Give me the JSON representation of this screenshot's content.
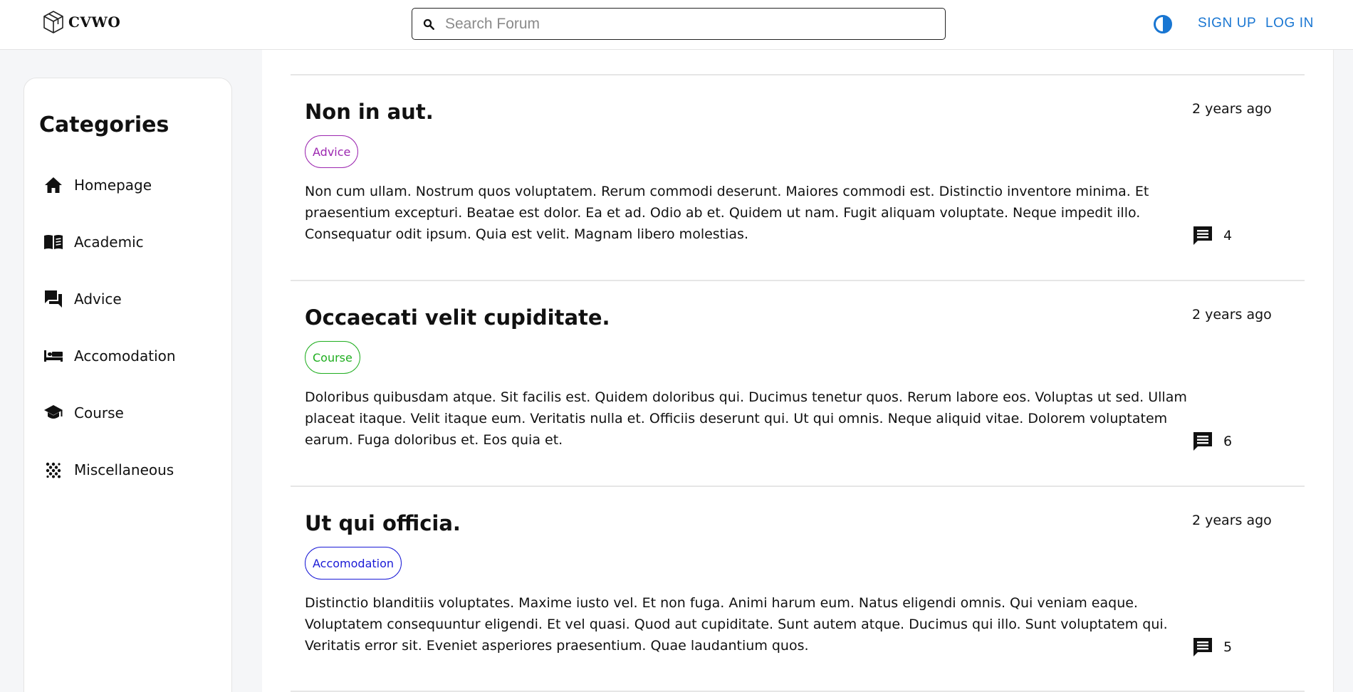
{
  "header": {
    "logo_text": "CVWO",
    "search_placeholder": "Search Forum",
    "signup_label": "SIGN UP",
    "login_label": "LOG IN",
    "accent_color": "#1976d2"
  },
  "sidebar": {
    "title": "Categories",
    "items": [
      {
        "label": "Homepage",
        "icon": "home-icon"
      },
      {
        "label": "Academic",
        "icon": "book-icon"
      },
      {
        "label": "Advice",
        "icon": "forum-icon"
      },
      {
        "label": "Accomodation",
        "icon": "bed-icon"
      },
      {
        "label": "Course",
        "icon": "school-icon"
      },
      {
        "label": "Miscellaneous",
        "icon": "scatter-icon"
      }
    ]
  },
  "posts": [
    {
      "title": "Non in aut.",
      "time": "2 years ago",
      "tag": "Advice",
      "tag_color": "#9c27b0",
      "body": "Non cum ullam. Nostrum quos voluptatem. Rerum commodi deserunt. Maiores commodi est. Distinctio inventore minima. Et praesentium excepturi. Beatae est dolor. Ea et ad. Odio ab et. Quidem ut nam. Fugit aliquam voluptate. Neque impedit illo. Consequatur odit ipsum. Quia est velit. Magnam libero molestias.",
      "comments": "4"
    },
    {
      "title": "Occaecati velit cupiditate.",
      "time": "2 years ago",
      "tag": "Course",
      "tag_color": "#1fae1f",
      "body": "Doloribus quibusdam atque. Sit facilis est. Quidem doloribus qui. Ducimus tenetur quos. Rerum labore eos. Voluptas ut sed. Ullam placeat itaque. Velit itaque eum. Veritatis nulla et. Officiis deserunt qui. Ut qui omnis. Neque aliquid vitae. Dolorem voluptatem earum. Fuga doloribus et. Eos quia et.",
      "comments": "6"
    },
    {
      "title": "Ut qui officia.",
      "time": "2 years ago",
      "tag": "Accomodation",
      "tag_color": "#1a1ad6",
      "body": "Distinctio blanditiis voluptates. Maxime iusto vel. Et non fuga. Animi harum eum. Natus eligendi omnis. Qui veniam eaque. Voluptatem consequuntur eligendi. Et vel quasi. Quod aut cupiditate. Sunt autem atque. Ducimus qui illo. Sunt voluptatem qui. Veritatis error sit. Eveniet asperiores praesentium. Quae laudantium quos.",
      "comments": "5"
    }
  ]
}
